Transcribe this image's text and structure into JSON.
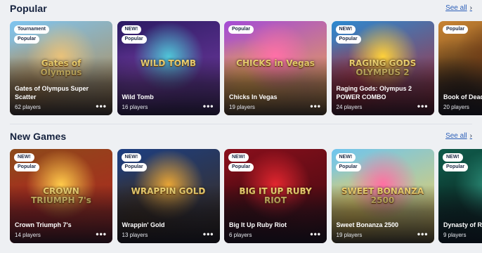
{
  "popular": {
    "title": "Popular",
    "see_all": "See all",
    "games": [
      {
        "name": "Gates of Olympus Super Scatter",
        "players": "62 players",
        "badges": [
          "Tournament",
          "Popular"
        ],
        "logo": "Gates of Olympus",
        "colors": [
          "#7ec4f0",
          "#e9c27a",
          "#b9843f"
        ]
      },
      {
        "name": "Wild Tomb",
        "players": "16 players",
        "badges": [
          "NEW!",
          "Popular"
        ],
        "logo": "WILD TOMB",
        "colors": [
          "#2b1b63",
          "#4fc6d8",
          "#7b3ea8"
        ]
      },
      {
        "name": "Chicks In Vegas",
        "players": "19 players",
        "badges": [
          "Popular"
        ],
        "logo": "CHICKS in Vegas",
        "colors": [
          "#a44bd6",
          "#ff6fa8",
          "#f6b23a"
        ]
      },
      {
        "name": "Raging Gods: Olympus 2 POWER COMBO",
        "players": "24 players",
        "badges": [
          "NEW!",
          "Popular"
        ],
        "logo": "RAGING GODS OLYMPUS 2",
        "colors": [
          "#2c89d0",
          "#ffd23a",
          "#b8232a"
        ]
      },
      {
        "name": "Book of Dead",
        "players": "20 players",
        "badges": [
          "Popular"
        ],
        "logo": "",
        "colors": [
          "#c98433",
          "#6e3b16",
          "#2a1a0d"
        ]
      }
    ]
  },
  "new_games": {
    "title": "New Games",
    "see_all": "See all",
    "games": [
      {
        "name": "Crown Triumph 7's",
        "players": "14 players",
        "badges": [
          "NEW!",
          "Popular"
        ],
        "logo": "CROWN TRIUMPH 7's",
        "colors": [
          "#8d4a1a",
          "#ffcb4a",
          "#b32020"
        ]
      },
      {
        "name": "Wrappin' Gold",
        "players": "13 players",
        "badges": [
          "NEW!",
          "Popular"
        ],
        "logo": "WRAPPIN GOLD",
        "colors": [
          "#1d3f82",
          "#e8a536",
          "#3f2a12"
        ]
      },
      {
        "name": "Big It Up Ruby Riot",
        "players": "6 players",
        "badges": [
          "NEW!",
          "Popular"
        ],
        "logo": "BIG IT UP RUBY RIOT",
        "colors": [
          "#8a0f1c",
          "#e3262f",
          "#3a0a0f"
        ]
      },
      {
        "name": "Sweet Bonanza 2500",
        "players": "19 players",
        "badges": [
          "NEW!",
          "Popular"
        ],
        "logo": "SWEET BONANZA 2500",
        "colors": [
          "#6ec5ef",
          "#ff6fa3",
          "#ffd04a"
        ]
      },
      {
        "name": "Dynasty of Ra",
        "players": "9 players",
        "badges": [
          "NEW!",
          "Popular"
        ],
        "logo": "",
        "colors": [
          "#0f5a4a",
          "#2b8d78",
          "#0b2a24"
        ]
      }
    ]
  }
}
